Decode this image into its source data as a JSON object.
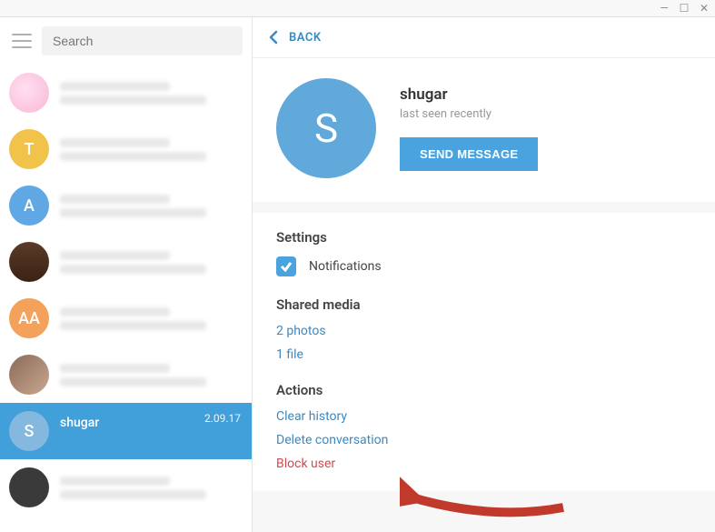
{
  "window": {
    "minimize": "—",
    "maximize": "☐",
    "close": "✕"
  },
  "sidebar": {
    "search_placeholder": "Search",
    "chats": [
      {
        "name": "",
        "time": "",
        "avatar_letter": "",
        "blurred": true
      },
      {
        "name": "",
        "time": "",
        "avatar_letter": "T",
        "blurred": true
      },
      {
        "name": "",
        "time": "",
        "avatar_letter": "A",
        "blurred": true
      },
      {
        "name": "",
        "time": "",
        "avatar_letter": "",
        "blurred": true
      },
      {
        "name": "",
        "time": "",
        "avatar_letter": "AA",
        "blurred": true
      },
      {
        "name": "",
        "time": "",
        "avatar_letter": "",
        "blurred": true
      },
      {
        "name": "shugar",
        "time": "2.09.17",
        "avatar_letter": "S",
        "selected": true
      },
      {
        "name": "",
        "time": "",
        "avatar_letter": "",
        "blurred": true
      }
    ]
  },
  "back_label": "BACK",
  "profile": {
    "avatar_letter": "S",
    "name": "shugar",
    "status": "last seen recently",
    "send_message": "SEND MESSAGE"
  },
  "settings": {
    "title": "Settings",
    "notifications": "Notifications"
  },
  "shared_media": {
    "title": "Shared media",
    "photos": "2 photos",
    "file": "1 file"
  },
  "actions": {
    "title": "Actions",
    "clear_history": "Clear history",
    "delete_conversation": "Delete conversation",
    "block_user": "Block user"
  }
}
